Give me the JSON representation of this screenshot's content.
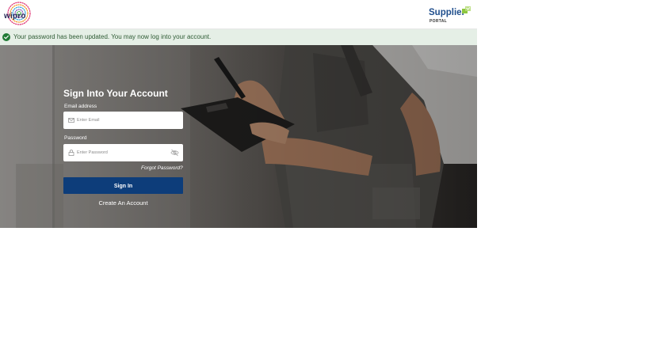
{
  "header": {
    "brand_left": "wipro",
    "brand_right_title": "Supplier",
    "brand_right_subtitle": "PORTAL"
  },
  "alert": {
    "message": "Your password has been updated. You may now log into your account.",
    "icon": "check-circle-icon",
    "color": "#2e5b34",
    "background": "#e5efe6"
  },
  "login": {
    "title": "Sign Into Your Account",
    "email_label": "Email address",
    "email_placeholder": "Enter Email",
    "email_value": "",
    "password_label": "Password",
    "password_placeholder": "Enter Password",
    "password_value": "",
    "forgot_label": "Forgot Password?",
    "signin_label": "Sign In",
    "create_label": "Create An Account"
  },
  "colors": {
    "primary_button": "#0d3d7a",
    "brand_blue": "#1f4e8c",
    "brand_green": "#8dc63f"
  }
}
